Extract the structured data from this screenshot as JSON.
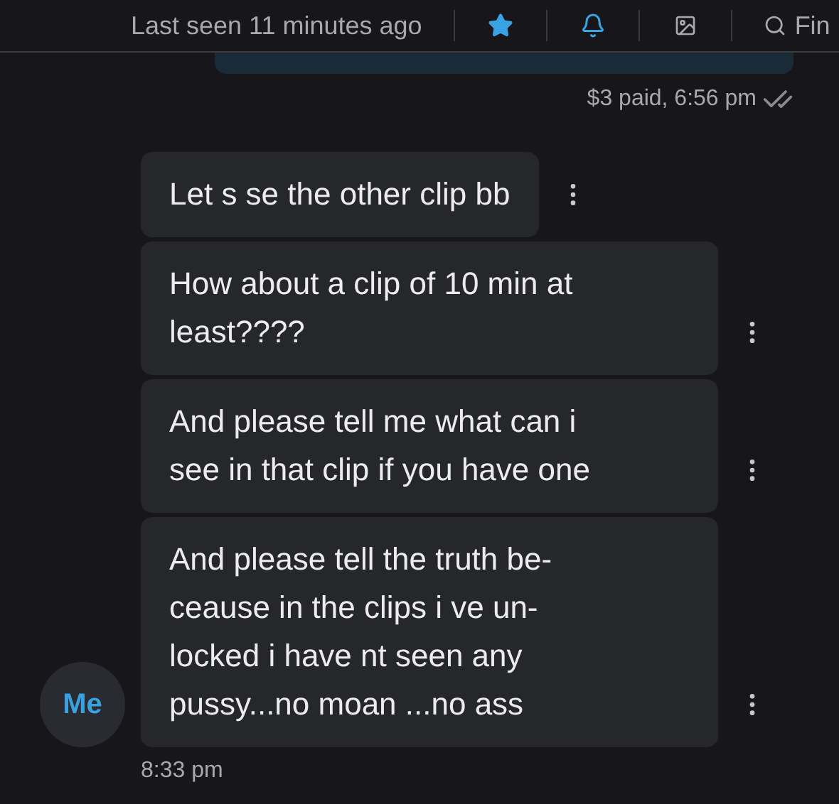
{
  "header": {
    "status": "Last seen 11 minutes ago",
    "starred": true,
    "notifications_on": true,
    "search_label": "Fin"
  },
  "previous_message": {
    "receipt": "$3 paid, 6:56 pm",
    "read": true
  },
  "avatar": "Me",
  "messages": [
    {
      "lines": [
        "Let s se the other clip bb"
      ]
    },
    {
      "lines": [
        "How about a clip of 10 min at",
        "least????"
      ]
    },
    {
      "lines": [
        "And please tell me what can i",
        "see in that clip if you have one"
      ]
    },
    {
      "lines": [
        "And please tell the truth be-",
        "ceause in the clips i ve un-",
        "locked i have nt seen any",
        "pussy...no moan ...no ass"
      ]
    }
  ],
  "time": "8:33 pm"
}
